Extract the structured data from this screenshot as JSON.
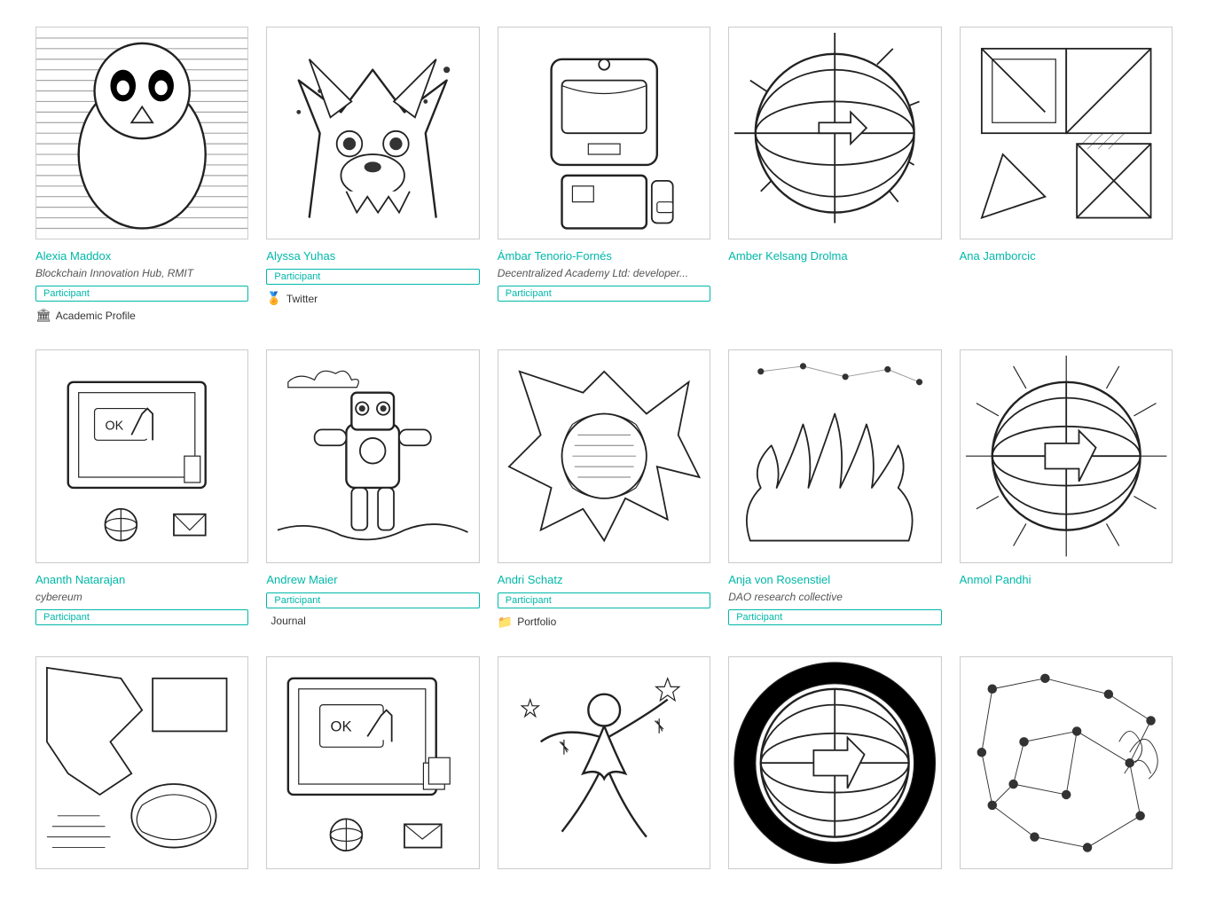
{
  "cards": [
    {
      "id": "alexia-maddox",
      "name": "Alexia Maddox",
      "org": "Blockchain Innovation Hub, RMIT",
      "badge": "Participant",
      "link_icon": "🏛",
      "link_text": "Academic Profile",
      "sketch": "bird"
    },
    {
      "id": "alyssa-yuhas",
      "name": "Alyssa Yuhas",
      "org": "",
      "badge": "Participant",
      "link_icon": "🏅",
      "link_text": "Twitter",
      "sketch": "wolf"
    },
    {
      "id": "ambar-tenorio",
      "name": "Ámbar Tenorio-Fornés",
      "org": "Decentralized Academy Ltd: developer...",
      "badge": "Participant",
      "link_icon": "",
      "link_text": "",
      "sketch": "robot"
    },
    {
      "id": "amber-kelsang",
      "name": "Amber Kelsang Drolma",
      "org": "",
      "badge": "",
      "link_icon": "",
      "link_text": "",
      "sketch": "globe-sun"
    },
    {
      "id": "ana-jamborcic",
      "name": "Ana Jamborcic",
      "org": "",
      "badge": "",
      "link_icon": "",
      "link_text": "",
      "sketch": "abstract1"
    },
    {
      "id": "ananth-natarajan",
      "name": "Ananth Natarajan",
      "org": "cybereum",
      "badge": "Participant",
      "link_icon": "",
      "link_text": "",
      "sketch": "computer"
    },
    {
      "id": "andrew-maier",
      "name": "Andrew Maier",
      "org": "",
      "badge": "Participant",
      "link_icon": "",
      "link_text": "Journal",
      "sketch": "robot2"
    },
    {
      "id": "andri-schatz",
      "name": "Andri Schatz",
      "org": "",
      "badge": "Participant",
      "link_icon": "📁",
      "link_text": "Portfolio",
      "sketch": "abstract2"
    },
    {
      "id": "anja-von-rosenstiel",
      "name": "Anja von Rosenstiel",
      "org": "DAO research collective",
      "badge": "Participant",
      "link_icon": "",
      "link_text": "",
      "sketch": "fire"
    },
    {
      "id": "anmol-pandhi",
      "name": "Anmol Pandhi",
      "org": "",
      "badge": "",
      "link_icon": "",
      "link_text": "",
      "sketch": "globe-sun2"
    },
    {
      "id": "card-11",
      "name": "",
      "org": "",
      "badge": "",
      "link_icon": "",
      "link_text": "",
      "sketch": "abstract3"
    },
    {
      "id": "card-12",
      "name": "",
      "org": "",
      "badge": "",
      "link_icon": "",
      "link_text": "",
      "sketch": "computer2"
    },
    {
      "id": "card-13",
      "name": "",
      "org": "",
      "badge": "",
      "link_icon": "",
      "link_text": "",
      "sketch": "dancer"
    },
    {
      "id": "card-14",
      "name": "",
      "org": "",
      "badge": "",
      "link_icon": "",
      "link_text": "",
      "sketch": "globe-sun3"
    },
    {
      "id": "card-15",
      "name": "",
      "org": "",
      "badge": "",
      "link_icon": "",
      "link_text": "",
      "sketch": "network"
    }
  ]
}
